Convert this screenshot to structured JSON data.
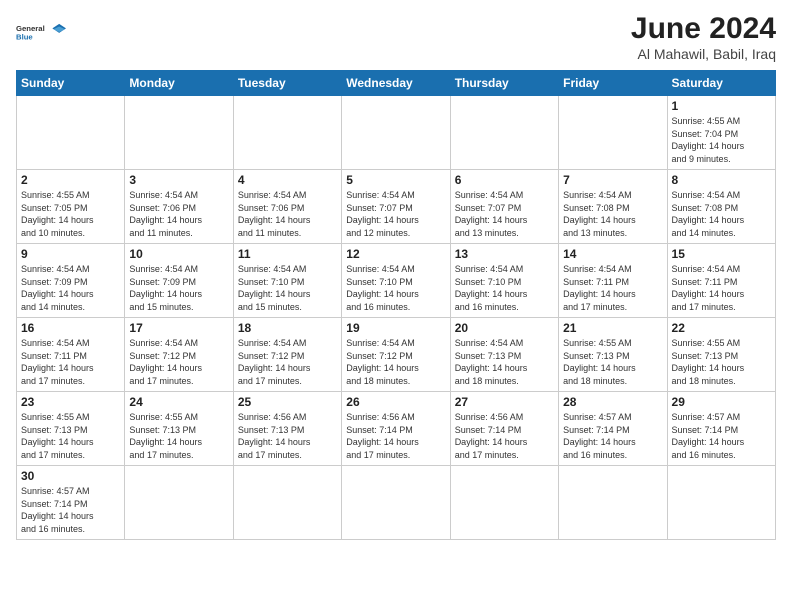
{
  "header": {
    "logo_general": "General",
    "logo_blue": "Blue",
    "title": "June 2024",
    "subtitle": "Al Mahawil, Babil, Iraq"
  },
  "weekdays": [
    "Sunday",
    "Monday",
    "Tuesday",
    "Wednesday",
    "Thursday",
    "Friday",
    "Saturday"
  ],
  "weeks": [
    [
      {
        "day": "",
        "info": ""
      },
      {
        "day": "",
        "info": ""
      },
      {
        "day": "",
        "info": ""
      },
      {
        "day": "",
        "info": ""
      },
      {
        "day": "",
        "info": ""
      },
      {
        "day": "",
        "info": ""
      },
      {
        "day": "1",
        "info": "Sunrise: 4:55 AM\nSunset: 7:04 PM\nDaylight: 14 hours\nand 9 minutes."
      }
    ],
    [
      {
        "day": "2",
        "info": "Sunrise: 4:55 AM\nSunset: 7:05 PM\nDaylight: 14 hours\nand 10 minutes."
      },
      {
        "day": "3",
        "info": "Sunrise: 4:54 AM\nSunset: 7:06 PM\nDaylight: 14 hours\nand 11 minutes."
      },
      {
        "day": "4",
        "info": "Sunrise: 4:54 AM\nSunset: 7:06 PM\nDaylight: 14 hours\nand 11 minutes."
      },
      {
        "day": "5",
        "info": "Sunrise: 4:54 AM\nSunset: 7:07 PM\nDaylight: 14 hours\nand 12 minutes."
      },
      {
        "day": "6",
        "info": "Sunrise: 4:54 AM\nSunset: 7:07 PM\nDaylight: 14 hours\nand 13 minutes."
      },
      {
        "day": "7",
        "info": "Sunrise: 4:54 AM\nSunset: 7:08 PM\nDaylight: 14 hours\nand 13 minutes."
      },
      {
        "day": "8",
        "info": "Sunrise: 4:54 AM\nSunset: 7:08 PM\nDaylight: 14 hours\nand 14 minutes."
      }
    ],
    [
      {
        "day": "9",
        "info": "Sunrise: 4:54 AM\nSunset: 7:09 PM\nDaylight: 14 hours\nand 14 minutes."
      },
      {
        "day": "10",
        "info": "Sunrise: 4:54 AM\nSunset: 7:09 PM\nDaylight: 14 hours\nand 15 minutes."
      },
      {
        "day": "11",
        "info": "Sunrise: 4:54 AM\nSunset: 7:10 PM\nDaylight: 14 hours\nand 15 minutes."
      },
      {
        "day": "12",
        "info": "Sunrise: 4:54 AM\nSunset: 7:10 PM\nDaylight: 14 hours\nand 16 minutes."
      },
      {
        "day": "13",
        "info": "Sunrise: 4:54 AM\nSunset: 7:10 PM\nDaylight: 14 hours\nand 16 minutes."
      },
      {
        "day": "14",
        "info": "Sunrise: 4:54 AM\nSunset: 7:11 PM\nDaylight: 14 hours\nand 17 minutes."
      },
      {
        "day": "15",
        "info": "Sunrise: 4:54 AM\nSunset: 7:11 PM\nDaylight: 14 hours\nand 17 minutes."
      }
    ],
    [
      {
        "day": "16",
        "info": "Sunrise: 4:54 AM\nSunset: 7:11 PM\nDaylight: 14 hours\nand 17 minutes."
      },
      {
        "day": "17",
        "info": "Sunrise: 4:54 AM\nSunset: 7:12 PM\nDaylight: 14 hours\nand 17 minutes."
      },
      {
        "day": "18",
        "info": "Sunrise: 4:54 AM\nSunset: 7:12 PM\nDaylight: 14 hours\nand 17 minutes."
      },
      {
        "day": "19",
        "info": "Sunrise: 4:54 AM\nSunset: 7:12 PM\nDaylight: 14 hours\nand 18 minutes."
      },
      {
        "day": "20",
        "info": "Sunrise: 4:54 AM\nSunset: 7:13 PM\nDaylight: 14 hours\nand 18 minutes."
      },
      {
        "day": "21",
        "info": "Sunrise: 4:55 AM\nSunset: 7:13 PM\nDaylight: 14 hours\nand 18 minutes."
      },
      {
        "day": "22",
        "info": "Sunrise: 4:55 AM\nSunset: 7:13 PM\nDaylight: 14 hours\nand 18 minutes."
      }
    ],
    [
      {
        "day": "23",
        "info": "Sunrise: 4:55 AM\nSunset: 7:13 PM\nDaylight: 14 hours\nand 17 minutes."
      },
      {
        "day": "24",
        "info": "Sunrise: 4:55 AM\nSunset: 7:13 PM\nDaylight: 14 hours\nand 17 minutes."
      },
      {
        "day": "25",
        "info": "Sunrise: 4:56 AM\nSunset: 7:13 PM\nDaylight: 14 hours\nand 17 minutes."
      },
      {
        "day": "26",
        "info": "Sunrise: 4:56 AM\nSunset: 7:14 PM\nDaylight: 14 hours\nand 17 minutes."
      },
      {
        "day": "27",
        "info": "Sunrise: 4:56 AM\nSunset: 7:14 PM\nDaylight: 14 hours\nand 17 minutes."
      },
      {
        "day": "28",
        "info": "Sunrise: 4:57 AM\nSunset: 7:14 PM\nDaylight: 14 hours\nand 16 minutes."
      },
      {
        "day": "29",
        "info": "Sunrise: 4:57 AM\nSunset: 7:14 PM\nDaylight: 14 hours\nand 16 minutes."
      }
    ],
    [
      {
        "day": "30",
        "info": "Sunrise: 4:57 AM\nSunset: 7:14 PM\nDaylight: 14 hours\nand 16 minutes."
      },
      {
        "day": "",
        "info": ""
      },
      {
        "day": "",
        "info": ""
      },
      {
        "day": "",
        "info": ""
      },
      {
        "day": "",
        "info": ""
      },
      {
        "day": "",
        "info": ""
      },
      {
        "day": "",
        "info": ""
      }
    ]
  ]
}
